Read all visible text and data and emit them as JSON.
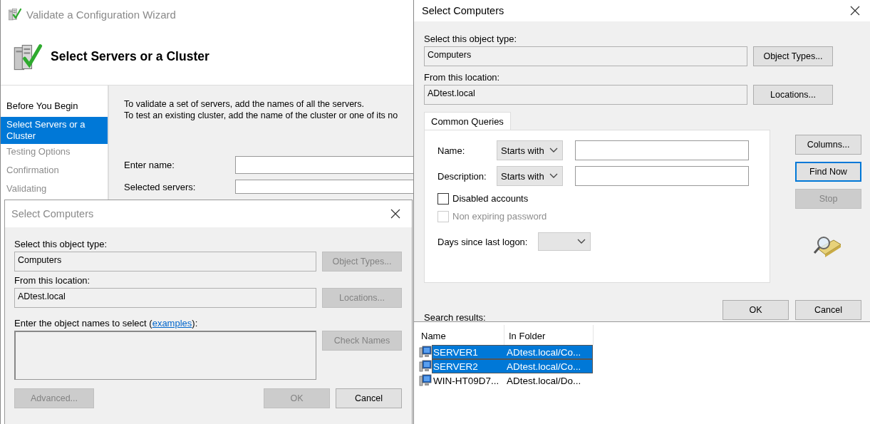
{
  "wizard": {
    "title": "Validate a Configuration Wizard",
    "heading": "Select Servers or a Cluster",
    "steps": [
      {
        "label": "Before You Begin",
        "selected": false,
        "disabled": false
      },
      {
        "label": "Select Servers or a Cluster",
        "selected": true,
        "disabled": false
      },
      {
        "label": "Testing Options",
        "selected": false,
        "disabled": true
      },
      {
        "label": "Confirmation",
        "selected": false,
        "disabled": true
      },
      {
        "label": "Validating",
        "selected": false,
        "disabled": true
      }
    ],
    "intro": [
      "To validate a set of servers, add the names of all the servers.",
      "To test an existing cluster, add the name of the cluster or one of its no"
    ],
    "enter_name_label": "Enter name:",
    "selected_servers_label": "Selected servers:"
  },
  "back_dialog": {
    "title": "Select Computers",
    "object_type_label": "Select this object type:",
    "object_type": "Computers",
    "object_types_button": {
      "label": "Object Types...",
      "disabled": true
    },
    "location_label": "From this location:",
    "location": "ADtest.local",
    "locations_button": {
      "label": "Locations...",
      "disabled": true
    },
    "names_label": {
      "before": "Enter the object names to select (",
      "link": "examples",
      "after": "):"
    },
    "check_names_button": {
      "label": "Check Names",
      "disabled": true
    },
    "advanced_button": {
      "label": "Advanced...",
      "disabled": true
    },
    "ok_button": {
      "label": "OK",
      "disabled": true
    },
    "cancel_button": {
      "label": "Cancel",
      "disabled": false
    }
  },
  "front_dialog": {
    "title": "Select Computers",
    "object_type_label": "Select this object type:",
    "object_type": "Computers",
    "object_types_button": {
      "label": "Object Types...",
      "disabled": false
    },
    "location_label": "From this location:",
    "location": "ADtest.local",
    "locations_button": {
      "label": "Locations...",
      "disabled": false
    },
    "tabs": [
      {
        "label": "Common Queries",
        "selected": true
      }
    ],
    "queries": [
      {
        "label": "Name:",
        "condition": "Starts with"
      },
      {
        "label": "Description:",
        "condition": "Starts with"
      }
    ],
    "checkboxes": [
      {
        "label": "Disabled accounts",
        "checked": false,
        "disabled": false
      },
      {
        "label": "Non expiring password",
        "checked": false,
        "disabled": true
      }
    ],
    "days_label": "Days since last logon:",
    "side_buttons": [
      {
        "label": "Columns...",
        "disabled": false,
        "default": false
      },
      {
        "label": "Find Now",
        "disabled": false,
        "default": true
      },
      {
        "label": "Stop",
        "disabled": true,
        "default": false
      }
    ],
    "ok_button": {
      "label": "OK",
      "disabled": false
    },
    "cancel_button": {
      "label": "Cancel",
      "disabled": false
    },
    "results_label": "Search results:",
    "results": {
      "columns": [
        "Name",
        "In Folder"
      ],
      "rows": [
        {
          "name": "SERVER1",
          "folder": "ADtest.local/Co...",
          "selected": true
        },
        {
          "name": "SERVER2",
          "folder": "ADtest.local/Co...",
          "selected": true
        },
        {
          "name": "WIN-HT09D7...",
          "folder": "ADtest.local/Do...",
          "selected": false
        }
      ]
    }
  }
}
